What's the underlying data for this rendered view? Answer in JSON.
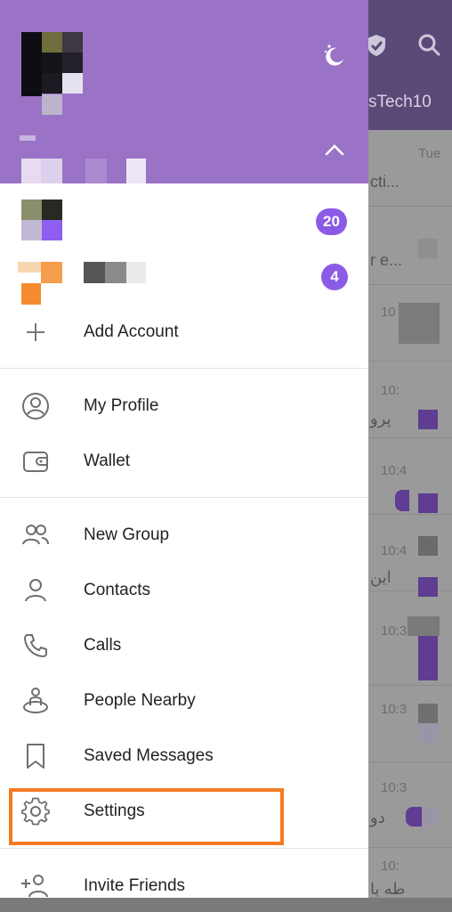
{
  "background": {
    "title": "sTech10",
    "rows": [
      {
        "time": "Tue",
        "snippet": "cti..."
      },
      {
        "time": "",
        "snippet": "r e..."
      },
      {
        "time": "10",
        "snippet": ""
      },
      {
        "time": "10:",
        "snippet": "پرو"
      },
      {
        "time": "10:4",
        "snippet": ""
      },
      {
        "time": "10:4",
        "snippet": "این"
      },
      {
        "time": "10:3",
        "snippet": ""
      },
      {
        "time": "10:3",
        "snippet": ""
      },
      {
        "time": "10:3",
        "snippet": "دو"
      },
      {
        "time": "10:",
        "snippet": "طه با"
      }
    ],
    "icons": [
      "shield-check-icon",
      "search-icon"
    ]
  },
  "drawer": {
    "header": {
      "theme_icon": "moon-stars-icon",
      "toggle_icon": "chevron-up-icon",
      "color": "#9a72c6"
    },
    "accounts": [
      {
        "badge": "20"
      },
      {
        "badge": "4"
      }
    ],
    "add_account_label": "Add Account",
    "menu": [
      {
        "label": "My Profile",
        "icon": "profile-circle-icon"
      },
      {
        "label": "Wallet",
        "icon": "wallet-icon"
      },
      {
        "label": "New Group",
        "icon": "group-icon"
      },
      {
        "label": "Contacts",
        "icon": "contact-icon"
      },
      {
        "label": "Calls",
        "icon": "phone-icon"
      },
      {
        "label": "People Nearby",
        "icon": "people-nearby-icon"
      },
      {
        "label": "Saved Messages",
        "icon": "bookmark-icon"
      },
      {
        "label": "Settings",
        "icon": "gear-icon"
      },
      {
        "label": "Invite Friends",
        "icon": "add-person-icon"
      }
    ],
    "accent_color": "#8b5be6",
    "highlight_color": "#f47a22"
  }
}
